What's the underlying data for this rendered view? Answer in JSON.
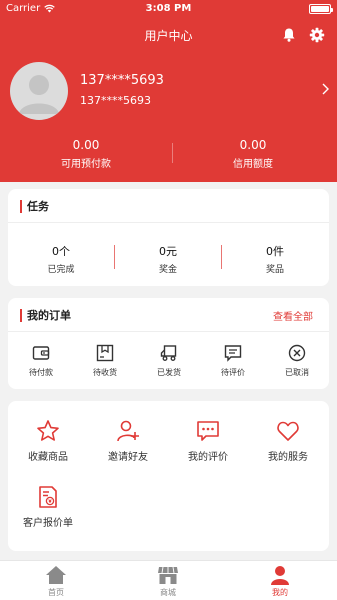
{
  "status_bar": {
    "carrier": "Carrier",
    "time": "3:08 PM"
  },
  "header": {
    "title": "用户中心",
    "bell_icon": "bell-icon",
    "settings_icon": "gear-icon"
  },
  "profile": {
    "name": "137****5693",
    "phone": "137****5693",
    "avatar_icon": "avatar-placeholder-icon"
  },
  "stats": [
    {
      "value": "0.00",
      "label": "可用预付款"
    },
    {
      "value": "0.00",
      "label": "信用额度"
    }
  ],
  "tasks": {
    "title": "任务",
    "items": [
      {
        "value": "0个",
        "label": "已完成"
      },
      {
        "value": "0元",
        "label": "奖金"
      },
      {
        "value": "0件",
        "label": "奖品"
      }
    ]
  },
  "orders": {
    "title": "我的订单",
    "view_all": "查看全部",
    "items": [
      {
        "label": "待付款",
        "icon": "wallet-icon"
      },
      {
        "label": "待收货",
        "icon": "package-icon"
      },
      {
        "label": "已发货",
        "icon": "truck-icon"
      },
      {
        "label": "待评价",
        "icon": "comment-icon"
      },
      {
        "label": "已取消",
        "icon": "cancel-icon"
      }
    ]
  },
  "services": [
    {
      "label": "收藏商品",
      "icon": "star-icon"
    },
    {
      "label": "邀请好友",
      "icon": "add-user-icon"
    },
    {
      "label": "我的评价",
      "icon": "chat-bubble-icon"
    },
    {
      "label": "我的服务",
      "icon": "heart-icon"
    },
    {
      "label": "客户报价单",
      "icon": "quote-document-icon"
    }
  ],
  "tabbar": [
    {
      "label": "首页",
      "icon": "home-icon",
      "active": false
    },
    {
      "label": "商城",
      "icon": "store-icon",
      "active": false
    },
    {
      "label": "我的",
      "icon": "user-icon",
      "active": true
    }
  ],
  "colors": {
    "brand": "#e03a36",
    "inactive": "#888888"
  }
}
